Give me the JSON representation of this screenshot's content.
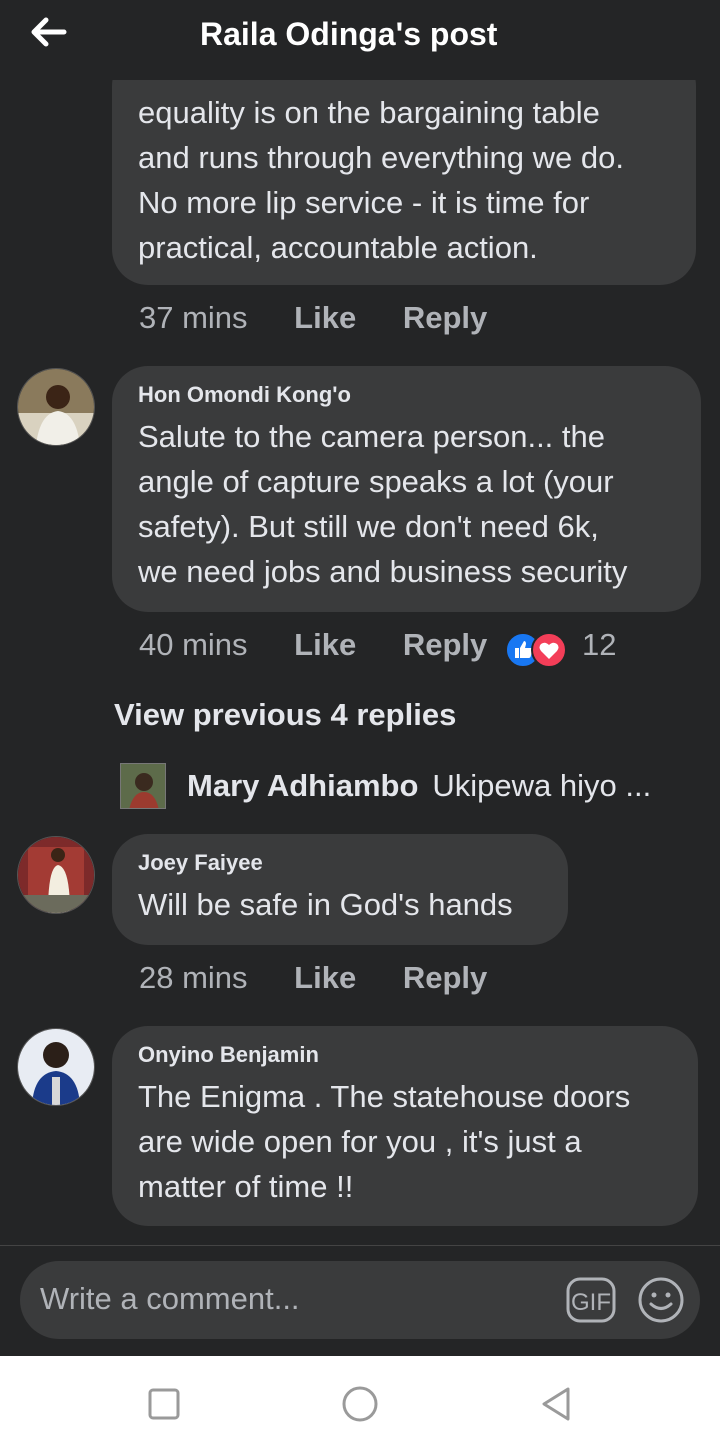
{
  "header": {
    "title": "Raila Odinga's post"
  },
  "comments": [
    {
      "text": "equality is on the bargaining table\nand runs through everything we do.\nNo more lip service - it is time for\npractical, accountable action.",
      "time": "37 mins",
      "like": "Like",
      "reply": "Reply"
    },
    {
      "author": "Hon Omondi Kong'o",
      "text": "Salute to the camera person... the\nangle of capture speaks a lot (your\nsafety). But still we don't need 6k,\nwe need jobs and business security",
      "time": "40 mins",
      "like": "Like",
      "reply": "Reply",
      "reaction_count": "12",
      "reaction_icons": [
        "like-icon",
        "love-icon"
      ],
      "view_previous": "View previous 4 replies",
      "reply_preview": {
        "author": "Mary Adhiambo",
        "text": "Ukipewa hiyo ..."
      }
    },
    {
      "author": "Joey Faiyee",
      "text": "Will be safe in God's hands",
      "time": "28 mins",
      "like": "Like",
      "reply": "Reply"
    },
    {
      "author": "Onyino Benjamin",
      "text": "The Enigma . The statehouse doors\nare wide open for you , it's just a\nmatter of time !!"
    }
  ],
  "composer": {
    "placeholder": "Write a comment...",
    "gif_label": "GIF"
  },
  "colors": {
    "background": "#242526",
    "bubble": "#3a3b3c",
    "like_blue": "#1877f2",
    "love_red": "#f33e58"
  }
}
